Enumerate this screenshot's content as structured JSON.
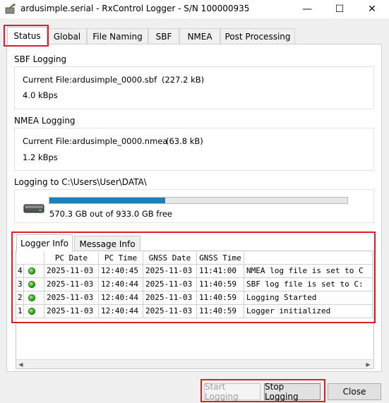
{
  "window": {
    "title": "ardusimple.serial - RxControl Logger - S/N 100000935",
    "minimize": "—",
    "maximize": "☐",
    "close": "✕"
  },
  "tabs": [
    "Status",
    "Global",
    "File Naming",
    "SBF",
    "NMEA",
    "Post Processing"
  ],
  "active_tab": "Status",
  "sbf": {
    "title": "SBF Logging",
    "current_file_label": "Current File:",
    "current_file": "ardusimple_0000.sbf",
    "size": "(227.2 kB)",
    "rate": "4.0 kBps"
  },
  "nmea": {
    "title": "NMEA Logging",
    "current_file_label": "Current File:",
    "current_file": "ardusimple_0000.nmea",
    "size": "(63.8 kB)",
    "rate": "1.2 kBps"
  },
  "disk": {
    "logging_to": "Logging to C:\\Users\\User\\DATA\\",
    "usage_text": "570.3 GB out of 933.0 GB free",
    "used_fraction": 0.389
  },
  "inner_tabs": [
    "Logger Info",
    "Message Info"
  ],
  "log_table": {
    "columns": [
      "",
      "PC Date",
      "PC Time",
      "GNSS Date",
      "GNSS Time",
      ""
    ],
    "rows": [
      {
        "n": "4",
        "pc_date": "2025-11-03",
        "pc_time": "12:40:45",
        "gnss_date": "2025-11-03",
        "gnss_time": "11:41:00",
        "message": "NMEA log file is set to C"
      },
      {
        "n": "3",
        "pc_date": "2025-11-03",
        "pc_time": "12:40:44",
        "gnss_date": "2025-11-03",
        "gnss_time": "11:40:59",
        "message": "SBF log file is set to C:"
      },
      {
        "n": "2",
        "pc_date": "2025-11-03",
        "pc_time": "12:40:44",
        "gnss_date": "2025-11-03",
        "gnss_time": "11:40:59",
        "message": "Logging Started"
      },
      {
        "n": "1",
        "pc_date": "2025-11-03",
        "pc_time": "12:40:44",
        "gnss_date": "2025-11-03",
        "gnss_time": "11:40:59",
        "message": "Logger initialized"
      }
    ]
  },
  "buttons": {
    "start": "Start Logging",
    "stop": "Stop Logging",
    "close": "Close"
  },
  "colors": {
    "highlight": "#e02020",
    "progress": "#1f7fb8",
    "status_led": "#22aa11"
  }
}
